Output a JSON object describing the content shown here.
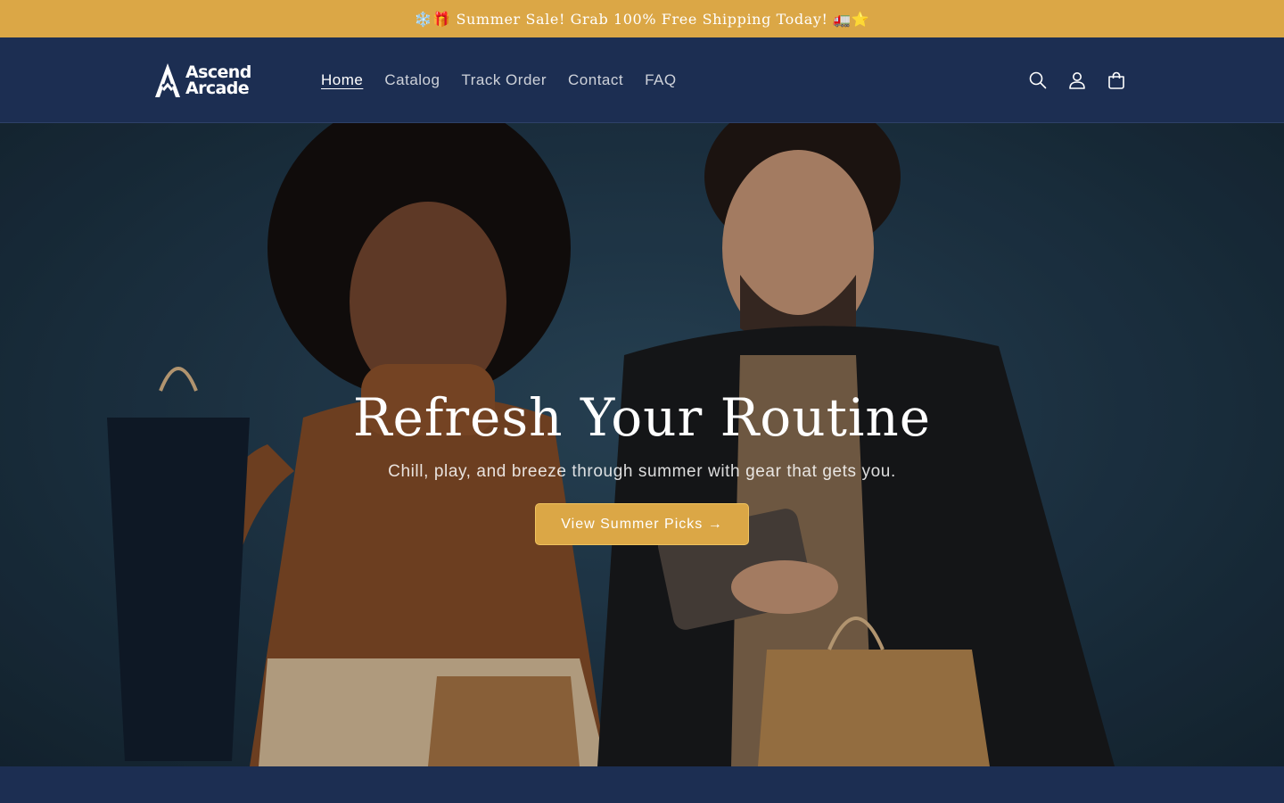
{
  "announcement": {
    "text": "❄️🎁 Summer Sale! Grab 100% Free Shipping Today! 🚛⭐"
  },
  "header": {
    "logo": {
      "line1": "Ascend",
      "line2": "Arcade"
    },
    "nav": [
      {
        "label": "Home",
        "active": true
      },
      {
        "label": "Catalog",
        "active": false
      },
      {
        "label": "Track Order",
        "active": false
      },
      {
        "label": "Contact",
        "active": false
      },
      {
        "label": "FAQ",
        "active": false
      }
    ],
    "icons": [
      "search-icon",
      "account-icon",
      "cart-icon"
    ]
  },
  "hero": {
    "title": "Refresh Your Routine",
    "subtitle": "Chill, play, and breeze through summer with gear that gets you.",
    "button_label": "View Summer Picks →"
  },
  "colors": {
    "announcement_bg": "#dba746",
    "header_bg": "#1c2e52",
    "accent": "#dba746"
  }
}
